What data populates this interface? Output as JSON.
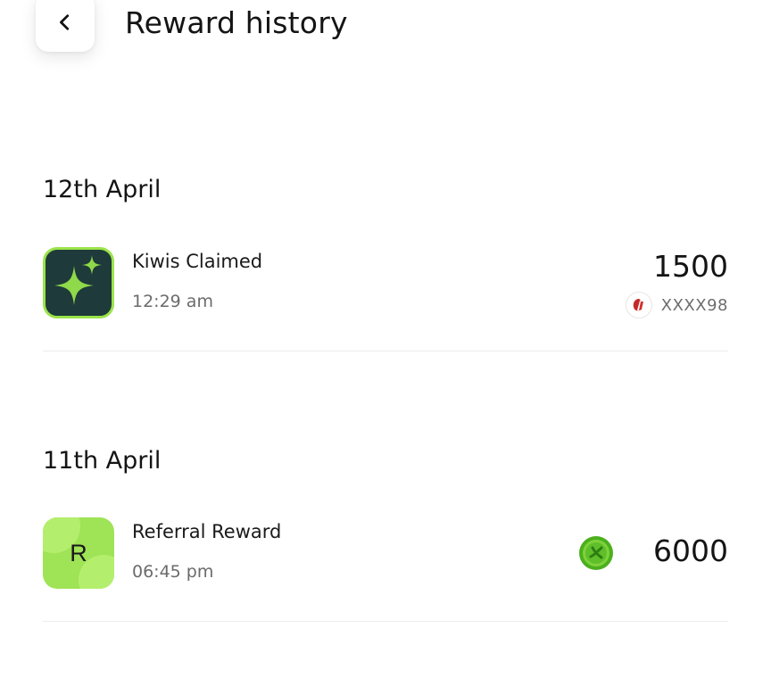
{
  "header": {
    "title": "Reward history",
    "back_icon": "chevron-left-icon"
  },
  "sections": [
    {
      "date": "12th April",
      "items": [
        {
          "title": "Kiwis Claimed",
          "time": "12:29 am",
          "amount": "1500",
          "card": "XXXX98",
          "icon": "sparkle-icon",
          "accent": "#9be34a"
        }
      ]
    },
    {
      "date": "11th April",
      "items": [
        {
          "title": "Referral Reward",
          "time": "06:45 pm",
          "amount": "6000",
          "avatar_letter": "R",
          "icon": "coin-icon",
          "accent": "#6ccc2c"
        }
      ]
    }
  ],
  "colors": {
    "kiwi_tile_bg": "#1e3a3a",
    "kiwi_green": "#9be34a",
    "referral_tile_bg": "#9fe356"
  }
}
